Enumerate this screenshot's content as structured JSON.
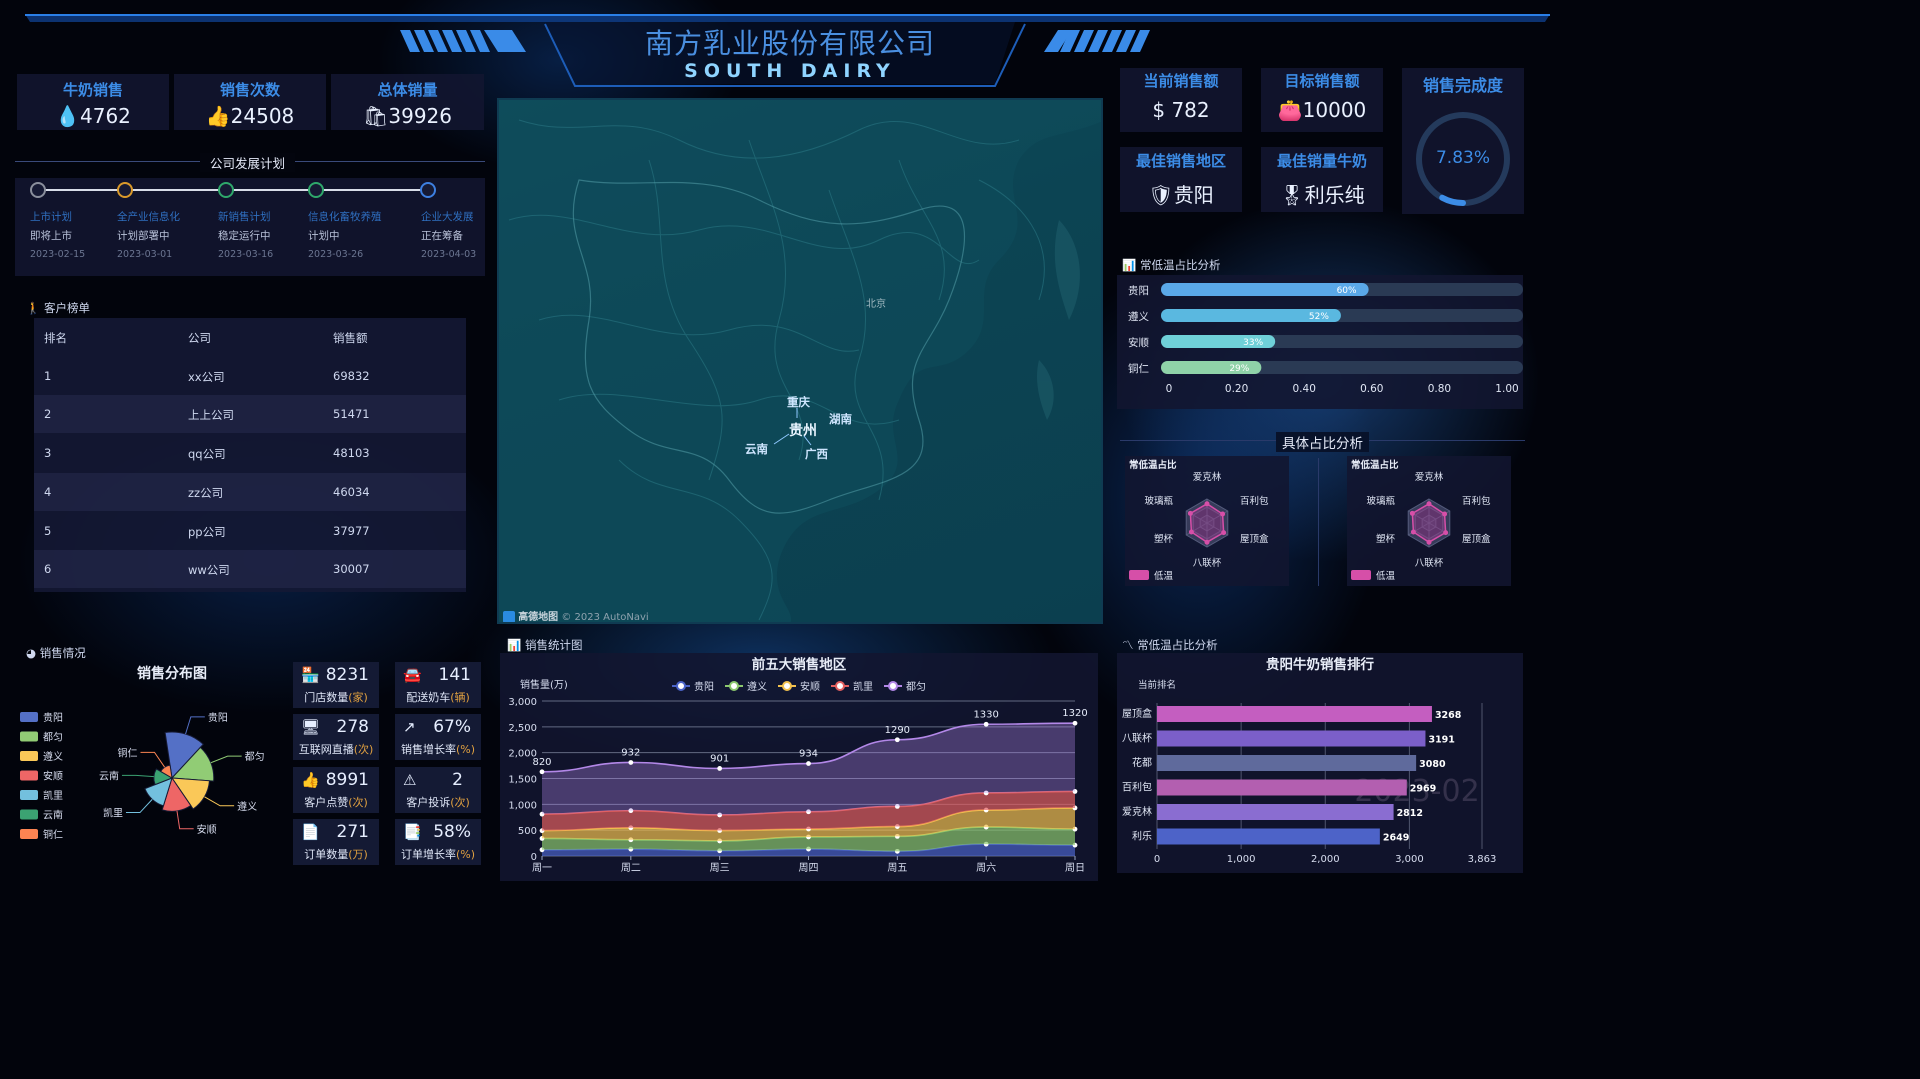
{
  "header": {
    "title": "南方乳业股份有限公司",
    "subtitle": "SOUTH DAIRY"
  },
  "left_stats": [
    {
      "title": "牛奶销售",
      "value": "4762",
      "icon": "droplet-icon"
    },
    {
      "title": "销售次数",
      "value": "24508",
      "icon": "thumbs-up-icon"
    },
    {
      "title": "总体销量",
      "value": "39926",
      "icon": "shopping-bag-icon"
    }
  ],
  "plan": {
    "title": "公司发展计划",
    "items": [
      {
        "name": "上市计划",
        "state": "即将上市",
        "date": "2023-02-15",
        "color": "#8a8f9c"
      },
      {
        "name": "全产业信息化",
        "state": "计划部署中",
        "date": "2023-03-01",
        "color": "#d99a2b"
      },
      {
        "name": "新销售计划",
        "state": "稳定运行中",
        "date": "2023-03-16",
        "color": "#2fa86b"
      },
      {
        "name": "信息化畜牧养殖",
        "state": "计划中",
        "date": "2023-03-26",
        "color": "#2fa86b"
      },
      {
        "name": "企业大发展",
        "state": "正在筹备",
        "date": "2023-04-03",
        "color": "#3d7fe0"
      }
    ]
  },
  "customers": {
    "title": "客户榜单",
    "headers": [
      "排名",
      "公司",
      "销售额"
    ],
    "rows": [
      [
        "1",
        "xx公司",
        "69832"
      ],
      [
        "2",
        "上上公司",
        "51471"
      ],
      [
        "3",
        "qq公司",
        "48103"
      ],
      [
        "4",
        "zz公司",
        "46034"
      ],
      [
        "5",
        "pp公司",
        "37977"
      ],
      [
        "6",
        "ww公司",
        "30007"
      ]
    ]
  },
  "sales_section": {
    "title": "销售情况"
  },
  "stats_section": {
    "title": "销售统计图"
  },
  "kpis": [
    {
      "value": "8231",
      "label": "门店数量",
      "unit": "(家)",
      "icon": "store-icon"
    },
    {
      "value": "141",
      "label": "配送奶车",
      "unit": "(辆)",
      "icon": "car-icon"
    },
    {
      "value": "278",
      "label": "互联网直播",
      "unit": "(次)",
      "icon": "monitor-icon"
    },
    {
      "value": "67%",
      "label": "销售增长率",
      "unit": "(%)",
      "icon": "trend-up-icon"
    },
    {
      "value": "8991",
      "label": "客户点赞",
      "unit": "(次)",
      "icon": "thumbs-up-icon"
    },
    {
      "value": "2",
      "label": "客户投诉",
      "unit": "(次)",
      "icon": "warning-icon"
    },
    {
      "value": "271",
      "label": "订单数量",
      "unit": "(万)",
      "icon": "document-icon"
    },
    {
      "value": "58%",
      "label": "订单增长率",
      "unit": "(%)",
      "icon": "document-list-icon"
    }
  ],
  "right_stats": [
    {
      "title": "当前销售额",
      "value": "782",
      "prefix": "$",
      "icon": "dollar-icon"
    },
    {
      "title": "目标销售额",
      "value": "10000",
      "icon": "wallet-icon"
    },
    {
      "title": "最佳销售地区",
      "value": "贵阳",
      "icon": "shield-icon"
    },
    {
      "title": "最佳销量牛奶",
      "value": "利乐纯",
      "icon": "award-icon"
    }
  ],
  "completion": {
    "title": "销售完成度",
    "value": "7.83%",
    "fraction": 0.0783
  },
  "map": {
    "attribution": "高德地图",
    "copyright": "© 2023 AutoNavi",
    "labels": {
      "beijing": "北京",
      "chongqing": "重庆",
      "hunan": "湖南",
      "guizhou": "贵州",
      "yunnan": "云南",
      "guangxi": "广西"
    }
  },
  "temp_panel": {
    "title": "常低温占比分析"
  },
  "detail_panel": {
    "title": "具体占比分析"
  },
  "sales_rank_section": {
    "title": "常低温占比分析"
  },
  "chart_data": [
    {
      "type": "pie",
      "title": "销售分布图",
      "rose": true,
      "categories": [
        "贵阳",
        "都匀",
        "遵义",
        "安顺",
        "凯里",
        "云南",
        "铜仁"
      ],
      "values": [
        45,
        40,
        35,
        30,
        25,
        12,
        6
      ],
      "colors": [
        "#5470c6",
        "#91cc75",
        "#fac858",
        "#ee6666",
        "#73c0de",
        "#3ba272",
        "#fc8452"
      ],
      "legend_position": "left"
    },
    {
      "type": "area",
      "title": "前五大销售地区",
      "ylabel": "销售量(万)",
      "categories": [
        "周一",
        "周二",
        "周三",
        "周四",
        "周五",
        "周六",
        "周日"
      ],
      "ylim": [
        0,
        3000
      ],
      "yticks": [
        "0",
        "500",
        "1,000",
        "1,500",
        "2,000",
        "2,500",
        "3,000"
      ],
      "stacked": true,
      "series": [
        {
          "name": "贵阳",
          "color": "#4a63c8",
          "values": [
            120,
            132,
            101,
            134,
            90,
            230,
            210
          ]
        },
        {
          "name": "遵义",
          "color": "#8cc86e",
          "values": [
            220,
            182,
            191,
            234,
            290,
            330,
            310
          ]
        },
        {
          "name": "安顺",
          "color": "#f2c14e",
          "values": [
            150,
            232,
            201,
            154,
            190,
            330,
            410
          ]
        },
        {
          "name": "凯里",
          "color": "#e25f5f",
          "values": [
            320,
            332,
            301,
            334,
            390,
            330,
            320
          ]
        },
        {
          "name": "都匀",
          "color": "#b388e8",
          "values": [
            820,
            932,
            901,
            934,
            1290,
            1330,
            1320
          ]
        }
      ],
      "labels": [
        820,
        932,
        901,
        934,
        1290,
        1330,
        1320
      ],
      "legend_position": "top"
    },
    {
      "type": "bar",
      "orientation": "horizontal",
      "title": "常低温占比分析",
      "categories": [
        "贵阳",
        "遵义",
        "安顺",
        "铜仁"
      ],
      "values": [
        0.6,
        0.52,
        0.33,
        0.29
      ],
      "labels": [
        "60%",
        "52%",
        "33%",
        "29%"
      ],
      "xlim": [
        0,
        1
      ],
      "xticks": [
        "0",
        "0.20",
        "0.40",
        "0.60",
        "0.80",
        "1.00"
      ]
    },
    {
      "type": "radar",
      "title": "常低温占比",
      "indicators": [
        "爱克林",
        "百利包",
        "屋顶盒",
        "八联杯",
        "塑杯",
        "玻璃瓶"
      ],
      "series": [
        {
          "name": "低温",
          "color": "#d64fa8"
        }
      ]
    },
    {
      "type": "radar",
      "title": "常低温占比",
      "indicators": [
        "爱克林",
        "百利包",
        "屋顶盒",
        "八联杯",
        "塑杯",
        "玻璃瓶"
      ],
      "series": [
        {
          "name": "低温",
          "color": "#d64fa8"
        }
      ]
    },
    {
      "type": "bar",
      "orientation": "horizontal",
      "title": "贵阳牛奶销售排行",
      "subtitle": "当前排名",
      "categories": [
        "屋顶盒",
        "八联杯",
        "花都",
        "百利包",
        "爱克林",
        "利乐"
      ],
      "values": [
        3268,
        3191,
        3080,
        2969,
        2812,
        2649
      ],
      "xlim": [
        0,
        3863
      ],
      "xticks": [
        "0",
        "1,000",
        "2,000",
        "3,000",
        "3,863"
      ],
      "watermark": "2023-02",
      "colors": [
        "#c45ec0",
        "#7b5fc9",
        "#5f6a9c",
        "#b35fb0",
        "#8a6dd1",
        "#4d63c8"
      ]
    }
  ]
}
